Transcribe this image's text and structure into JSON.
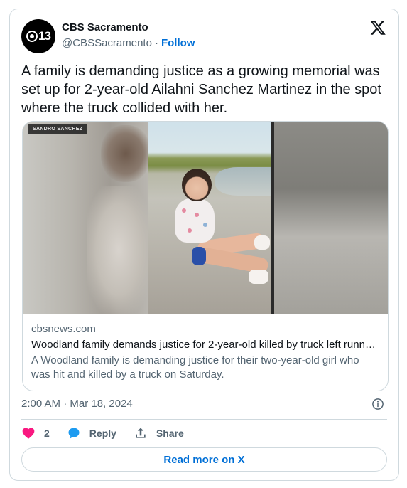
{
  "author": {
    "display_name": "CBS Sacramento",
    "handle": "@CBSSacramento",
    "separator": "·",
    "follow_label": "Follow",
    "avatar_text": "13"
  },
  "tweet": {
    "text": "A family is demanding justice as a growing memorial was set up for 2-year-old Ailahni Sanchez Martinez in the spot where the truck collided with her."
  },
  "media": {
    "credit": "SANDRO SANCHEZ"
  },
  "link_card": {
    "domain": "cbsnews.com",
    "title": "Woodland family demands justice for 2-year-old killed by truck left runn…",
    "description": "A Woodland family is demanding justice for their two-year-old girl who was hit and killed by a truck on Saturday."
  },
  "timestamp": "2:00 AM · Mar 18, 2024",
  "actions": {
    "like_count": "2",
    "reply_label": "Reply",
    "share_label": "Share"
  },
  "read_more_label": "Read more on X",
  "colors": {
    "accent": "#006fd6",
    "like": "#f91880",
    "reply": "#1d9bf0",
    "text_secondary": "#536471",
    "border": "#cfd9de"
  }
}
